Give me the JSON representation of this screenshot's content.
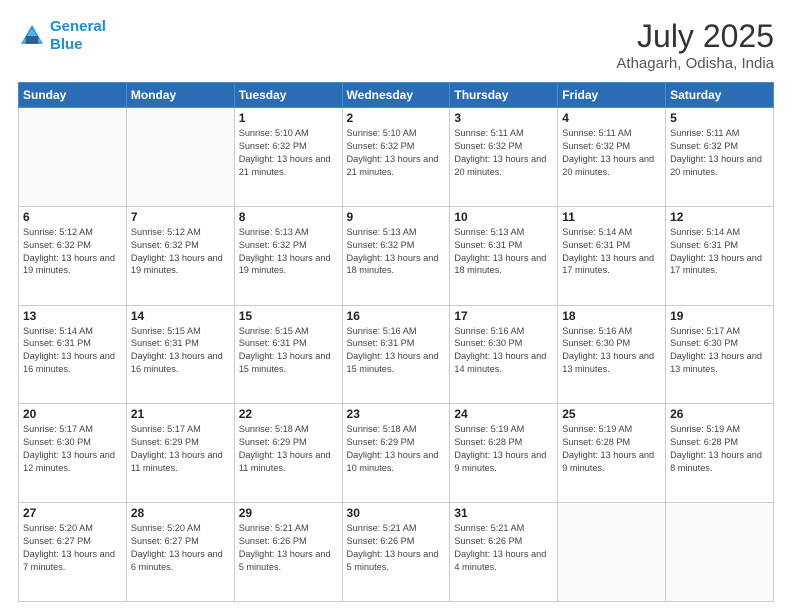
{
  "logo": {
    "line1": "General",
    "line2": "Blue"
  },
  "title": "July 2025",
  "subtitle": "Athagarh, Odisha, India",
  "days_header": [
    "Sunday",
    "Monday",
    "Tuesday",
    "Wednesday",
    "Thursday",
    "Friday",
    "Saturday"
  ],
  "weeks": [
    [
      {
        "day": "",
        "info": ""
      },
      {
        "day": "",
        "info": ""
      },
      {
        "day": "1",
        "info": "Sunrise: 5:10 AM\nSunset: 6:32 PM\nDaylight: 13 hours and 21 minutes."
      },
      {
        "day": "2",
        "info": "Sunrise: 5:10 AM\nSunset: 6:32 PM\nDaylight: 13 hours and 21 minutes."
      },
      {
        "day": "3",
        "info": "Sunrise: 5:11 AM\nSunset: 6:32 PM\nDaylight: 13 hours and 20 minutes."
      },
      {
        "day": "4",
        "info": "Sunrise: 5:11 AM\nSunset: 6:32 PM\nDaylight: 13 hours and 20 minutes."
      },
      {
        "day": "5",
        "info": "Sunrise: 5:11 AM\nSunset: 6:32 PM\nDaylight: 13 hours and 20 minutes."
      }
    ],
    [
      {
        "day": "6",
        "info": "Sunrise: 5:12 AM\nSunset: 6:32 PM\nDaylight: 13 hours and 19 minutes."
      },
      {
        "day": "7",
        "info": "Sunrise: 5:12 AM\nSunset: 6:32 PM\nDaylight: 13 hours and 19 minutes."
      },
      {
        "day": "8",
        "info": "Sunrise: 5:13 AM\nSunset: 6:32 PM\nDaylight: 13 hours and 19 minutes."
      },
      {
        "day": "9",
        "info": "Sunrise: 5:13 AM\nSunset: 6:32 PM\nDaylight: 13 hours and 18 minutes."
      },
      {
        "day": "10",
        "info": "Sunrise: 5:13 AM\nSunset: 6:31 PM\nDaylight: 13 hours and 18 minutes."
      },
      {
        "day": "11",
        "info": "Sunrise: 5:14 AM\nSunset: 6:31 PM\nDaylight: 13 hours and 17 minutes."
      },
      {
        "day": "12",
        "info": "Sunrise: 5:14 AM\nSunset: 6:31 PM\nDaylight: 13 hours and 17 minutes."
      }
    ],
    [
      {
        "day": "13",
        "info": "Sunrise: 5:14 AM\nSunset: 6:31 PM\nDaylight: 13 hours and 16 minutes."
      },
      {
        "day": "14",
        "info": "Sunrise: 5:15 AM\nSunset: 6:31 PM\nDaylight: 13 hours and 16 minutes."
      },
      {
        "day": "15",
        "info": "Sunrise: 5:15 AM\nSunset: 6:31 PM\nDaylight: 13 hours and 15 minutes."
      },
      {
        "day": "16",
        "info": "Sunrise: 5:16 AM\nSunset: 6:31 PM\nDaylight: 13 hours and 15 minutes."
      },
      {
        "day": "17",
        "info": "Sunrise: 5:16 AM\nSunset: 6:30 PM\nDaylight: 13 hours and 14 minutes."
      },
      {
        "day": "18",
        "info": "Sunrise: 5:16 AM\nSunset: 6:30 PM\nDaylight: 13 hours and 13 minutes."
      },
      {
        "day": "19",
        "info": "Sunrise: 5:17 AM\nSunset: 6:30 PM\nDaylight: 13 hours and 13 minutes."
      }
    ],
    [
      {
        "day": "20",
        "info": "Sunrise: 5:17 AM\nSunset: 6:30 PM\nDaylight: 13 hours and 12 minutes."
      },
      {
        "day": "21",
        "info": "Sunrise: 5:17 AM\nSunset: 6:29 PM\nDaylight: 13 hours and 11 minutes."
      },
      {
        "day": "22",
        "info": "Sunrise: 5:18 AM\nSunset: 6:29 PM\nDaylight: 13 hours and 11 minutes."
      },
      {
        "day": "23",
        "info": "Sunrise: 5:18 AM\nSunset: 6:29 PM\nDaylight: 13 hours and 10 minutes."
      },
      {
        "day": "24",
        "info": "Sunrise: 5:19 AM\nSunset: 6:28 PM\nDaylight: 13 hours and 9 minutes."
      },
      {
        "day": "25",
        "info": "Sunrise: 5:19 AM\nSunset: 6:28 PM\nDaylight: 13 hours and 9 minutes."
      },
      {
        "day": "26",
        "info": "Sunrise: 5:19 AM\nSunset: 6:28 PM\nDaylight: 13 hours and 8 minutes."
      }
    ],
    [
      {
        "day": "27",
        "info": "Sunrise: 5:20 AM\nSunset: 6:27 PM\nDaylight: 13 hours and 7 minutes."
      },
      {
        "day": "28",
        "info": "Sunrise: 5:20 AM\nSunset: 6:27 PM\nDaylight: 13 hours and 6 minutes."
      },
      {
        "day": "29",
        "info": "Sunrise: 5:21 AM\nSunset: 6:26 PM\nDaylight: 13 hours and 5 minutes."
      },
      {
        "day": "30",
        "info": "Sunrise: 5:21 AM\nSunset: 6:26 PM\nDaylight: 13 hours and 5 minutes."
      },
      {
        "day": "31",
        "info": "Sunrise: 5:21 AM\nSunset: 6:26 PM\nDaylight: 13 hours and 4 minutes."
      },
      {
        "day": "",
        "info": ""
      },
      {
        "day": "",
        "info": ""
      }
    ]
  ]
}
